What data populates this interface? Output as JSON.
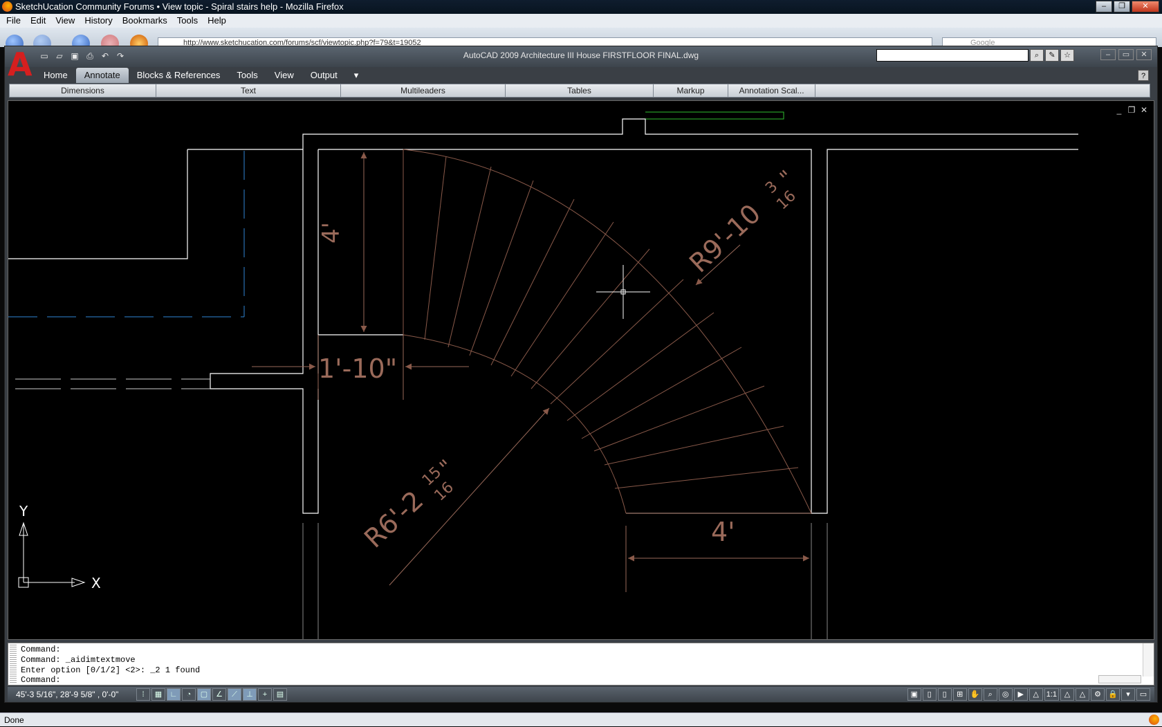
{
  "firefox": {
    "title": "SketchUcation Community Forums • View topic - Spiral stairs help - Mozilla Firefox",
    "menu": [
      "File",
      "Edit",
      "View",
      "History",
      "Bookmarks",
      "Tools",
      "Help"
    ],
    "url": "http://www.sketchucation.com/forums/scf/viewtopic.php?f=79&t=19052",
    "search_placeholder": "Google",
    "status": "Done"
  },
  "autocad": {
    "logo": "A",
    "caption": "AutoCAD 2009 Architecture III House FIRSTFLOOR FINAL.dwg",
    "tabs": [
      "Home",
      "Annotate",
      "Blocks & References",
      "Tools",
      "View",
      "Output"
    ],
    "active_tab": "Annotate",
    "panels": [
      {
        "label": "Dimensions",
        "w": 222
      },
      {
        "label": "Text",
        "w": 285
      },
      {
        "label": "Multileaders",
        "w": 237
      },
      {
        "label": "Tables",
        "w": 214
      },
      {
        "label": "Markup",
        "w": 109
      },
      {
        "label": "Annotation Scal...",
        "w": 126
      }
    ],
    "help": "?"
  },
  "drawing": {
    "dims": {
      "height": "4'",
      "width_bottom": "4'",
      "gap": "1'-10\"",
      "outer_radius": "R9'-10",
      "outer_frac_num": "3",
      "outer_frac_den": "16",
      "outer_inch": "\"",
      "inner_radius": "R6'-2",
      "inner_frac_num": "15",
      "inner_frac_den": "16",
      "inner_inch": "\""
    },
    "ucs": {
      "x": "X",
      "y": "Y"
    }
  },
  "command": {
    "lines": [
      "Command:",
      "Command: _aidimtextmove",
      "Enter option [0/1/2] <2>: _2 1 found"
    ],
    "prompt": "Command:"
  },
  "status": {
    "coords": "45'-3 5/16\", 28'-9 5/8\" , 0'-0\"",
    "scale": "1:1"
  },
  "colors": {
    "wall": "#ffffff",
    "stair": "#8a5a4a",
    "dim": "#9a6a5a",
    "hidden_blue": "#2f86d6",
    "green": "#2fbf2f"
  }
}
